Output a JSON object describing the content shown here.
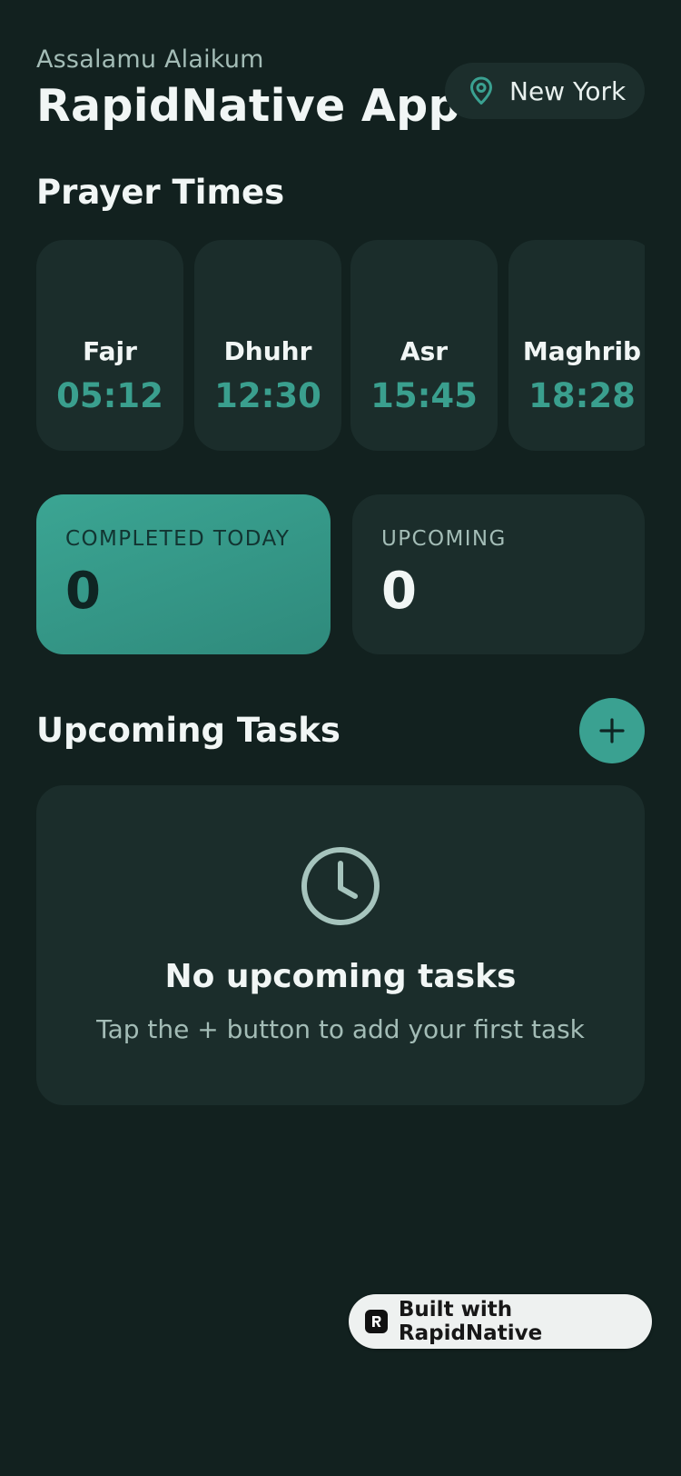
{
  "header": {
    "greeting": "Assalamu Alaikum",
    "title": "RapidNative App",
    "location": "New York"
  },
  "prayer": {
    "section_title": "Prayer Times",
    "items": [
      {
        "name": "Fajr",
        "time": "05:12"
      },
      {
        "name": "Dhuhr",
        "time": "12:30"
      },
      {
        "name": "Asr",
        "time": "15:45"
      },
      {
        "name": "Maghrib",
        "time": "18:28"
      }
    ]
  },
  "stats": {
    "completed_label": "COMPLETED TODAY",
    "completed_value": "0",
    "upcoming_label": "UPCOMING",
    "upcoming_value": "0"
  },
  "tasks": {
    "section_title": "Upcoming Tasks",
    "add_icon": "plus-icon",
    "empty_icon": "clock-icon",
    "empty_title": "No upcoming tasks",
    "empty_subtitle": "Tap the + button to add your first task"
  },
  "badge": {
    "text": "Built with RapidNative",
    "icon": "rapidnative-logo-icon"
  },
  "colors": {
    "background": "#12211f",
    "card": "#1b2d2b",
    "accent": "#3aa191",
    "muted_text": "#a3bcb6"
  }
}
